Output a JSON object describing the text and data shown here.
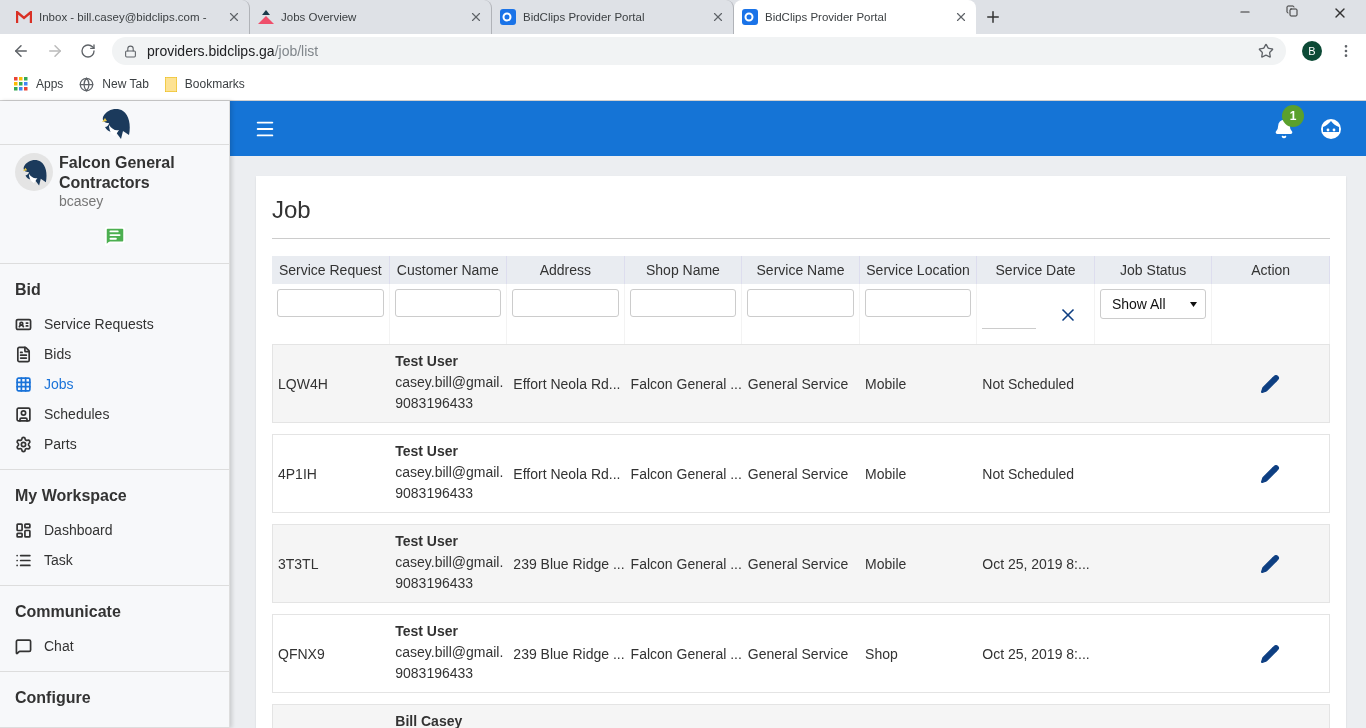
{
  "browser": {
    "tabs": [
      {
        "title": "Inbox - bill.casey@bidclips.com -",
        "selected": false
      },
      {
        "title": "Jobs Overview",
        "selected": false
      },
      {
        "title": "BidClips Provider Portal",
        "selected": false
      },
      {
        "title": "BidClips Provider Portal",
        "selected": true
      }
    ],
    "address": {
      "host": "providers.bidclips.ga",
      "path": "/job/list"
    },
    "profile": "B",
    "bookmarks": [
      "Apps",
      "New Tab",
      "Bookmarks"
    ]
  },
  "sidebar": {
    "company": "Falcon General Contractors",
    "user": "bcasey",
    "sections": [
      {
        "title": "Bid",
        "items": [
          {
            "label": "Service Requests",
            "selected": false
          },
          {
            "label": "Bids",
            "selected": false
          },
          {
            "label": "Jobs",
            "selected": true
          },
          {
            "label": "Schedules",
            "selected": false
          },
          {
            "label": "Parts",
            "selected": false
          }
        ]
      },
      {
        "title": "My Workspace",
        "items": [
          {
            "label": "Dashboard",
            "selected": false
          },
          {
            "label": "Task",
            "selected": false
          }
        ]
      },
      {
        "title": "Communicate",
        "items": [
          {
            "label": "Chat",
            "selected": false
          }
        ]
      },
      {
        "title": "Configure"
      }
    ]
  },
  "topbar": {
    "notifications": "1"
  },
  "page": {
    "title": "Job",
    "table": {
      "columns": [
        "Service Request",
        "Customer Name",
        "Address",
        "Shop Name",
        "Service Name",
        "Service Location",
        "Service Date",
        "Job Status",
        "Action"
      ],
      "status_filter": "Show All",
      "rows": [
        {
          "request": "LQW4H",
          "customer": "Test User",
          "email": "casey.bill@gmail.",
          "phone": "9083196433",
          "address": "Effort Neola Rd...",
          "shop": "Falcon General ...",
          "service": "General Service",
          "location": "Mobile",
          "date": "Not Scheduled"
        },
        {
          "request": "4P1IH",
          "customer": "Test User",
          "email": "casey.bill@gmail.",
          "phone": "9083196433",
          "address": "Effort Neola Rd...",
          "shop": "Falcon General ...",
          "service": "General Service",
          "location": "Mobile",
          "date": "Not Scheduled"
        },
        {
          "request": "3T3TL",
          "customer": "Test User",
          "email": "casey.bill@gmail.",
          "phone": "9083196433",
          "address": "239 Blue Ridge ...",
          "shop": "Falcon General ...",
          "service": "General Service",
          "location": "Mobile",
          "date": "Oct 25, 2019 8:..."
        },
        {
          "request": "QFNX9",
          "customer": "Test User",
          "email": "casey.bill@gmail.",
          "phone": "9083196433",
          "address": "239 Blue Ridge ...",
          "shop": "Falcon General ...",
          "service": "General Service",
          "location": "Shop",
          "date": "Oct 25, 2019 8:..."
        },
        {
          "customer": "Bill Casey"
        }
      ]
    }
  }
}
